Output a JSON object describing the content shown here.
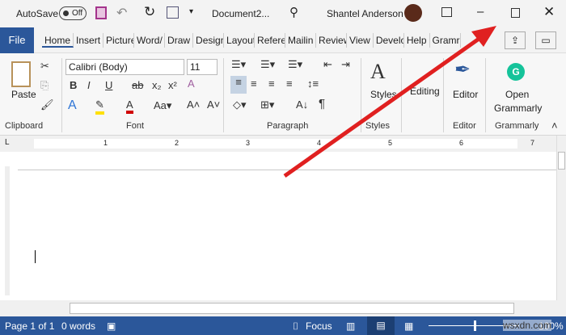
{
  "titlebar": {
    "autosave_label": "AutoSave",
    "autosave_state": "Off",
    "document_name": "Document2...",
    "user_name": "Shantel Anderson"
  },
  "tabs": [
    "File",
    "Home",
    "Insert",
    "Picture",
    "Word/",
    "Draw",
    "Design",
    "Layout",
    "Refere",
    "Mailin",
    "Review",
    "View",
    "Develo",
    "Help",
    "Gramr"
  ],
  "ribbon": {
    "clipboard": {
      "paste": "Paste",
      "label": "Clipboard"
    },
    "font": {
      "name": "Calibri (Body)",
      "size": "11",
      "label": "Font"
    },
    "paragraph": {
      "label": "Paragraph",
      "pilcrow": "¶"
    },
    "styles": {
      "button": "Styles",
      "label": "Styles"
    },
    "editing": {
      "button": "Editing"
    },
    "editor": {
      "button": "Editor",
      "label": "Editor"
    },
    "grammarly": {
      "button_line1": "Open",
      "button_line2": "Grammarly",
      "label": "Grammarly"
    }
  },
  "ruler": {
    "ticks": [
      "1",
      "2",
      "3",
      "4",
      "5",
      "6",
      "7"
    ]
  },
  "status": {
    "page": "Page 1 of 1",
    "words": "0 words",
    "focus": "Focus",
    "zoom": "100%"
  },
  "watermark": "wsxdn.com",
  "colors": {
    "brand": "#2b579a",
    "arrow": "#e02020"
  }
}
